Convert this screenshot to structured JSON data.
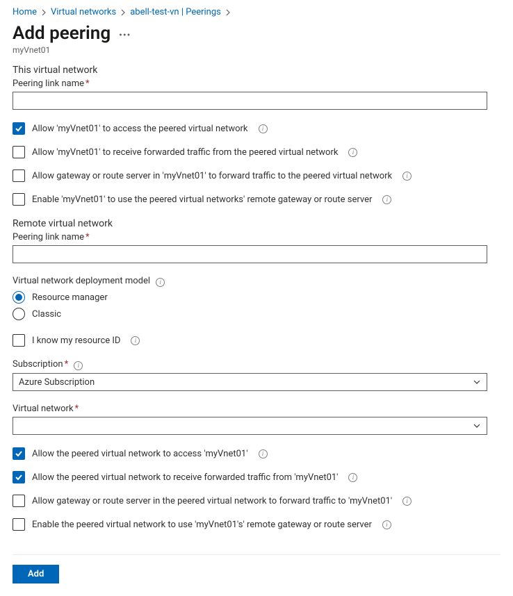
{
  "breadcrumb": {
    "items": [
      "Home",
      "Virtual networks",
      "abell-test-vn | Peerings"
    ]
  },
  "page": {
    "title": "Add peering",
    "subtitle": "myVnet01"
  },
  "thisVnet": {
    "section_title": "This virtual network",
    "peering_link_name_label": "Peering link name",
    "peering_link_name_value": "",
    "cb1": {
      "label": "Allow 'myVnet01' to access the peered virtual network",
      "checked": true
    },
    "cb2": {
      "label": "Allow 'myVnet01' to receive forwarded traffic from the peered virtual network",
      "checked": false
    },
    "cb3": {
      "label": "Allow gateway or route server in 'myVnet01' to forward traffic to the peered virtual network",
      "checked": false
    },
    "cb4": {
      "label": "Enable 'myVnet01' to use the peered virtual networks' remote gateway or route server",
      "checked": false
    }
  },
  "remoteVnet": {
    "section_title": "Remote virtual network",
    "peering_link_name_label": "Peering link name",
    "peering_link_name_value": "",
    "deployment_model_label": "Virtual network deployment model",
    "deploy_rm": {
      "label": "Resource manager",
      "checked": true
    },
    "deploy_classic": {
      "label": "Classic",
      "checked": false
    },
    "know_resource_id": {
      "label": "I know my resource ID",
      "checked": false
    },
    "subscription_label": "Subscription",
    "subscription_value": "Azure Subscription",
    "vnet_label": "Virtual network",
    "vnet_value": "",
    "cb1": {
      "label": "Allow the peered virtual network to access 'myVnet01'",
      "checked": true
    },
    "cb2": {
      "label": "Allow the peered virtual network to receive forwarded traffic from 'myVnet01'",
      "checked": true
    },
    "cb3": {
      "label": "Allow gateway or route server in the peered virtual network to forward traffic to 'myVnet01'",
      "checked": false
    },
    "cb4": {
      "label": "Enable the peered virtual network to use 'myVnet01's' remote gateway or route server",
      "checked": false
    }
  },
  "footer": {
    "add_label": "Add"
  }
}
